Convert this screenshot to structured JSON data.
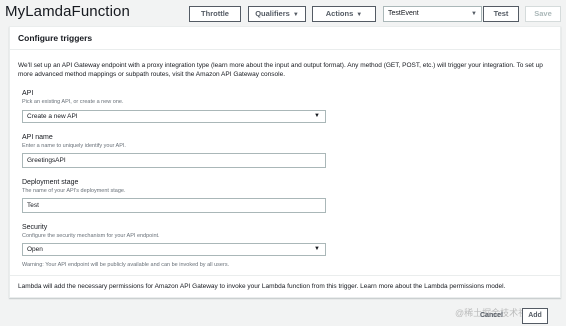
{
  "header": {
    "function_name": "MyLamdaFunction",
    "throttle_label": "Throttle",
    "qualifiers_label": "Qualifiers",
    "actions_label": "Actions",
    "test_event_value": "TestEvent",
    "test_label": "Test",
    "save_label": "Save"
  },
  "panel": {
    "title": "Configure triggers",
    "intro": "We'll set up an API Gateway endpoint with a proxy integration type (learn more about the input and output format). Any method (GET, POST, etc.) will trigger your integration. To set up more advanced method mappings or subpath routes, visit the Amazon API Gateway console.",
    "api": {
      "label": "API",
      "description": "Pick an existing API, or create a new one.",
      "value": "Create a new API"
    },
    "api_name": {
      "label": "API name",
      "description": "Enter a name to uniquely identify your API.",
      "value": "GreetingsAPI"
    },
    "stage": {
      "label": "Deployment stage",
      "description": "The name of your API's deployment stage.",
      "value": "Test"
    },
    "security": {
      "label": "Security",
      "description": "Configure the security mechanism for your API endpoint.",
      "value": "Open"
    },
    "warning": "Warning: Your API endpoint will be publicly available and can be invoked by all users.",
    "permissions_note": "Lambda will add the necessary permissions for Amazon API Gateway to invoke your Lambda function from this trigger. Learn more about the Lambda permissions model."
  },
  "footer": {
    "cancel_label": "Cancel",
    "add_label": "Add"
  },
  "watermark": "@稀土掘金技术社区",
  "icons": {
    "caret": "caret-down-icon"
  },
  "colors": {
    "background": "#f2f3f3",
    "panel": "#ffffff",
    "border": "#aab7b8",
    "button_text": "#545b64"
  }
}
